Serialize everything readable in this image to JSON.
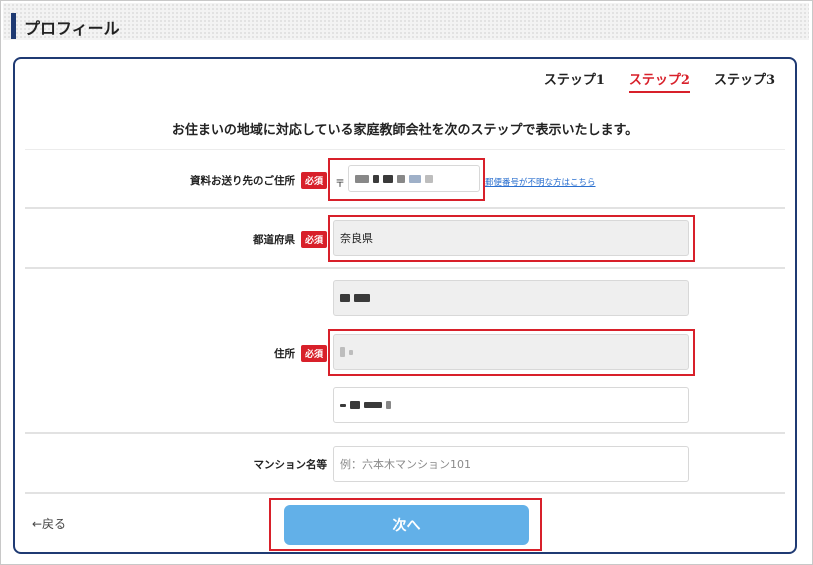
{
  "header": {
    "title": "プロフィール"
  },
  "steps": [
    {
      "label": "ステップ1",
      "active": false
    },
    {
      "label": "ステップ2",
      "active": true
    },
    {
      "label": "ステップ3",
      "active": false
    }
  ],
  "lead_text": "お住まいの地域に対応している家庭教師会社を次のステップで表示いたします。",
  "required_badge": "必須",
  "fields": {
    "postal": {
      "label": "資料お送り先のご住所",
      "mark": "〒",
      "link": "郵便番号が不明な方はこちら"
    },
    "prefecture": {
      "label": "都道府県",
      "value": "奈良県"
    },
    "address": {
      "label": "住所"
    },
    "mansion": {
      "label": "マンション名等",
      "placeholder": "例：六本木マンション101"
    }
  },
  "footer": {
    "back": "←戻る",
    "next": "次へ"
  },
  "colors": {
    "accent_red": "#d8202a",
    "navy": "#1f3a73",
    "button_blue": "#62b0e8"
  }
}
